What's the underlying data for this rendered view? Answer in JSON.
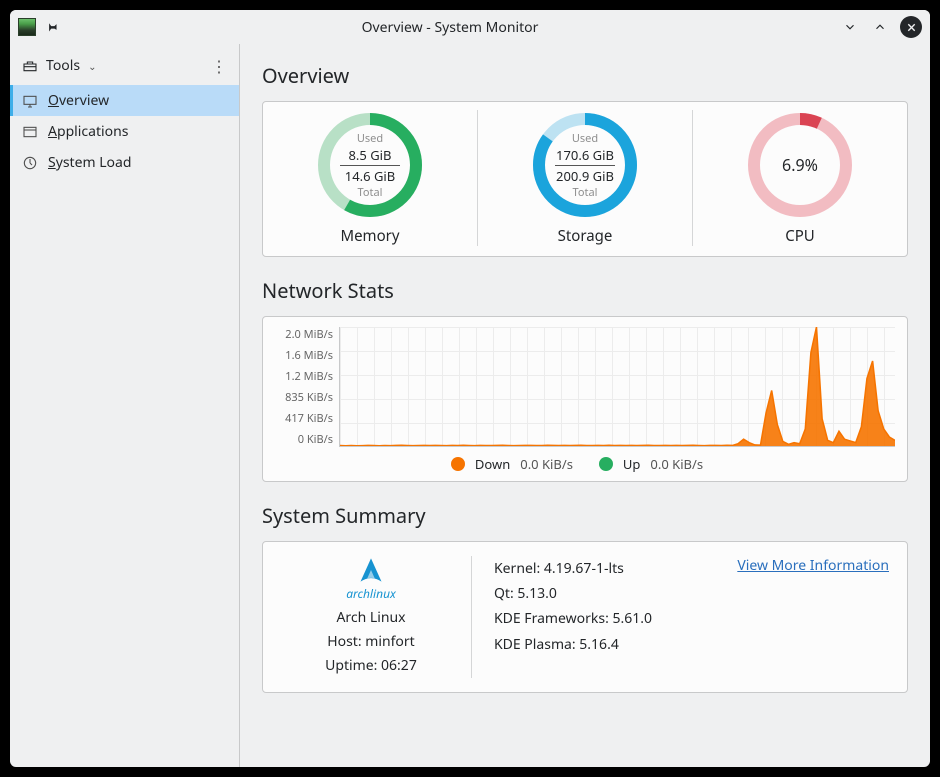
{
  "window": {
    "title": "Overview - System Monitor"
  },
  "sidebar": {
    "tools_label": "Tools",
    "items": [
      {
        "label": "Overview",
        "accel": "O",
        "icon": "monitor-icon",
        "selected": true
      },
      {
        "label": "Applications",
        "accel": "A",
        "icon": "window-icon",
        "selected": false
      },
      {
        "label": "System Load",
        "accel": "S",
        "icon": "gauge-icon",
        "selected": false
      }
    ]
  },
  "overview": {
    "heading": "Overview",
    "gauges": [
      {
        "key": "memory",
        "title": "Memory",
        "used_label": "Used",
        "total_label": "Total",
        "used": "8.5 GiB",
        "total": "14.6 GiB",
        "percent": 58.2,
        "color": "#27ae60",
        "track": "#b8e0c6"
      },
      {
        "key": "storage",
        "title": "Storage",
        "used_label": "Used",
        "total_label": "Total",
        "used": "170.6 GiB",
        "total": "200.9 GiB",
        "percent": 84.9,
        "color": "#1ba4dc",
        "track": "#bde2f2"
      },
      {
        "key": "cpu",
        "title": "CPU",
        "value": "6.9%",
        "percent": 6.9,
        "color": "#da4453",
        "track": "#f2bcc2"
      }
    ]
  },
  "network": {
    "heading": "Network Stats",
    "y_ticks": [
      "2.0 MiB/s",
      "1.6 MiB/s",
      "1.2 MiB/s",
      "835 KiB/s",
      "417 KiB/s",
      "0 KiB/s"
    ],
    "legend": {
      "down_label": "Down",
      "down_value": "0.0 KiB/s",
      "up_label": "Up",
      "up_value": "0.0 KiB/s"
    },
    "colors": {
      "down": "#f67400",
      "up": "#27ae60"
    }
  },
  "summary": {
    "heading": "System Summary",
    "distro_name": "Arch Linux",
    "distro_logo_text": "archlinux",
    "host_line": "Host: minfort",
    "uptime_line": "Uptime: 06:27",
    "details": [
      "Kernel: 4.19.67-1-lts",
      "Qt: 5.13.0",
      "KDE Frameworks: 5.61.0",
      "KDE Plasma: 5.16.4"
    ],
    "more_link": "View More Information"
  },
  "chart_data": {
    "type": "line",
    "title": "Network Stats",
    "y_ticks_kib_s": [
      0,
      417,
      835,
      1229,
      1638,
      2048
    ],
    "ylim_kib_s": [
      0,
      2100
    ],
    "ylabel": "",
    "xlabel": "",
    "x": [
      0,
      1,
      2,
      3,
      4,
      5,
      6,
      7,
      8,
      9,
      10,
      11,
      12,
      13,
      14,
      15,
      16,
      17,
      18,
      19,
      20,
      21,
      22,
      23,
      24,
      25,
      26,
      27,
      28,
      29,
      30,
      31,
      32,
      33,
      34,
      35,
      36,
      37,
      38,
      39,
      40,
      41,
      42,
      43,
      44,
      45,
      46,
      47,
      48,
      49,
      50,
      51,
      52,
      53,
      54,
      55,
      56,
      57,
      58,
      59,
      60,
      61,
      62,
      63,
      64,
      65,
      66,
      67,
      68,
      69,
      70,
      71,
      72,
      73,
      74,
      75,
      76,
      77,
      78,
      79,
      80,
      81,
      82,
      83,
      84,
      85,
      86,
      87,
      88,
      89,
      90,
      91,
      92,
      93,
      94,
      95,
      96,
      97,
      98,
      99
    ],
    "series": [
      {
        "name": "Down",
        "color": "#f67400",
        "values_kib_s": [
          8,
          6,
          9,
          5,
          7,
          10,
          8,
          6,
          9,
          7,
          10,
          12,
          9,
          7,
          8,
          10,
          9,
          11,
          8,
          7,
          10,
          9,
          12,
          8,
          7,
          11,
          9,
          8,
          10,
          12,
          9,
          7,
          8,
          10,
          11,
          9,
          8,
          12,
          10,
          9,
          11,
          8,
          10,
          12,
          9,
          8,
          10,
          9,
          12,
          8,
          10,
          9,
          11,
          8,
          10,
          12,
          9,
          8,
          10,
          9,
          11,
          8,
          10,
          12,
          9,
          7,
          10,
          11,
          8,
          12,
          10,
          40,
          120,
          60,
          20,
          15,
          580,
          980,
          380,
          80,
          30,
          60,
          40,
          300,
          1650,
          2100,
          480,
          100,
          60,
          260,
          120,
          90,
          60,
          340,
          1190,
          1500,
          620,
          300,
          160,
          100
        ]
      },
      {
        "name": "Up",
        "color": "#27ae60",
        "values_kib_s": [
          0,
          0,
          0,
          0,
          0,
          0,
          0,
          0,
          0,
          0,
          0,
          0,
          0,
          0,
          0,
          0,
          0,
          0,
          0,
          0,
          0,
          0,
          0,
          0,
          0,
          0,
          0,
          0,
          0,
          0,
          0,
          0,
          0,
          0,
          0,
          0,
          0,
          0,
          0,
          0,
          0,
          0,
          0,
          0,
          0,
          0,
          0,
          0,
          0,
          0,
          0,
          0,
          0,
          0,
          0,
          0,
          0,
          0,
          0,
          0,
          0,
          0,
          0,
          0,
          0,
          0,
          0,
          0,
          0,
          0,
          0,
          0,
          0,
          0,
          0,
          0,
          0,
          0,
          0,
          0,
          0,
          0,
          0,
          0,
          0,
          0,
          0,
          0,
          0,
          0,
          0,
          0,
          0,
          0,
          0,
          0,
          0,
          0,
          0,
          0
        ]
      }
    ]
  }
}
